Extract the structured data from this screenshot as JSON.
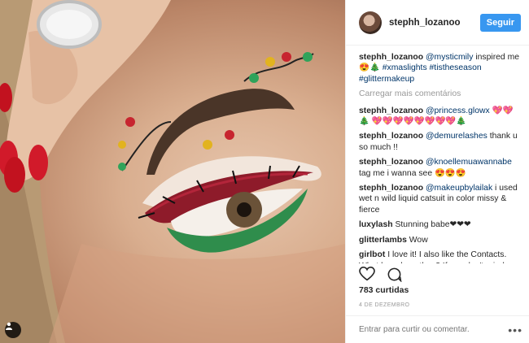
{
  "post": {
    "image_alt_icons": [
      "makeup-eye-photo"
    ],
    "header": {
      "username": "stephh_lozanoo",
      "follow_label": "Seguir"
    },
    "caption": {
      "username": "stephh_lozanoo",
      "mention": "@mysticmily",
      "text": " inspired me 😍🎄",
      "hashtags": "#xmaslights #tistheseason #glittermakeup"
    },
    "load_more_label": "Carregar mais comentários",
    "comments": [
      {
        "username": "stephh_lozanoo",
        "mention": "@princess.glowx",
        "text": " 💖💖🎄 💖💖💖💖💖💖💖💖🎄"
      },
      {
        "username": "stephh_lozanoo",
        "mention": "@demurelashes",
        "text": " thank u so much !!"
      },
      {
        "username": "stephh_lozanoo",
        "mention": "@knoellemuawannabe",
        "text": " tag me i wanna see 😍😍😍"
      },
      {
        "username": "stephh_lozanoo",
        "mention": "@makeupbylailak",
        "text": " i used wet n wild liquid catsuit in color missy & fierce"
      },
      {
        "username": "luxylash",
        "mention": "",
        "text": " Stunning babe❤❤❤"
      },
      {
        "username": "glitterlambs",
        "mention": "",
        "text": " Wow"
      },
      {
        "username": "girlbot",
        "mention": "",
        "text": " I love it! I also like the Contacts. What brand are they? If you don't mind sharing would really appreciate it 😊"
      }
    ],
    "likes_text": "783 curtidas",
    "date_text": "4 DE DEZEMBRO",
    "footer": {
      "placeholder": "Entrar para curtir ou comentar.",
      "options_label": "•••"
    },
    "colors": {
      "accent": "#3897f0",
      "link": "#003569",
      "muted": "#999999",
      "nail": "#d11a2a"
    }
  }
}
